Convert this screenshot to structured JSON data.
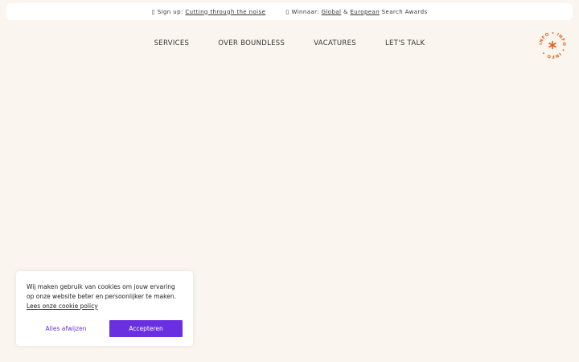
{
  "announcement": {
    "signup_glyph": "▯",
    "signup_prefix": "Sign up: ",
    "signup_link": "Cutting through the noise",
    "awards_glyph": "▯",
    "awards_prefix": "Winnaar: ",
    "awards_link_global": "Global",
    "awards_amp": " & ",
    "awards_link_european": "European",
    "awards_suffix": " Search Awards"
  },
  "nav": {
    "items": [
      {
        "label": "SERVICES"
      },
      {
        "label": "OVER BOUNDLESS"
      },
      {
        "label": "VACATURES"
      },
      {
        "label": "LET'S TALK"
      }
    ]
  },
  "info_badge": {
    "text": "INFO • INFO • INFO •",
    "accent_color": "#e0621e",
    "icon": "asterisk-icon"
  },
  "cookie_banner": {
    "message": "Wij maken gebruik van cookies om jouw ervaring op onze website beter en persoonlijker te maken. ",
    "policy_link": "Lees onze cookie policy",
    "reject_label": "Alles afwijzen",
    "accept_label": "Accepteren",
    "accent_color": "#6a2fe0"
  }
}
